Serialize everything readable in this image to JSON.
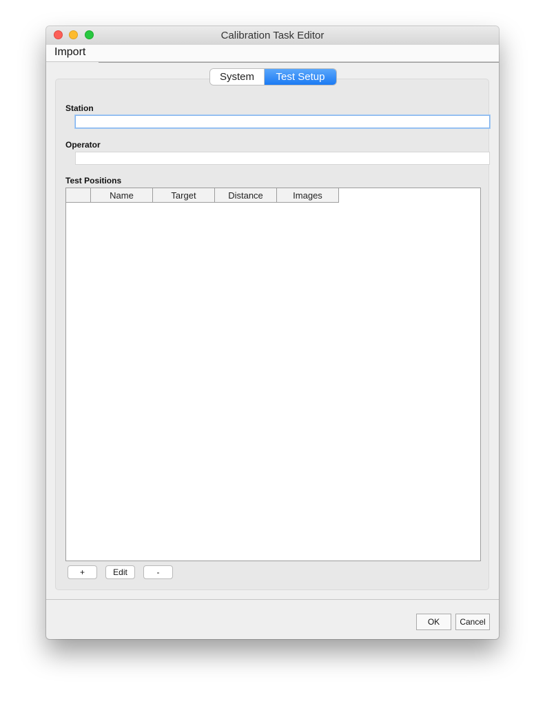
{
  "window": {
    "title": "Calibration Task Editor"
  },
  "menubar": {
    "import_label": "Import"
  },
  "tabs": [
    {
      "label": "System",
      "selected": false
    },
    {
      "label": "Test Setup",
      "selected": true
    }
  ],
  "form": {
    "station": {
      "label": "Station",
      "value": ""
    },
    "operator": {
      "label": "Operator",
      "value": ""
    },
    "test_positions": {
      "label": "Test Positions",
      "columns": [
        "",
        "Name",
        "Target",
        "Distance",
        "Images"
      ],
      "rows": []
    }
  },
  "table_buttons": {
    "add_label": "+",
    "edit_label": "Edit",
    "remove_label": "-"
  },
  "footer": {
    "ok_label": "OK",
    "cancel_label": "Cancel"
  },
  "colors": {
    "accent": "#1b7af3",
    "focus_ring": "#7fb2ee"
  }
}
